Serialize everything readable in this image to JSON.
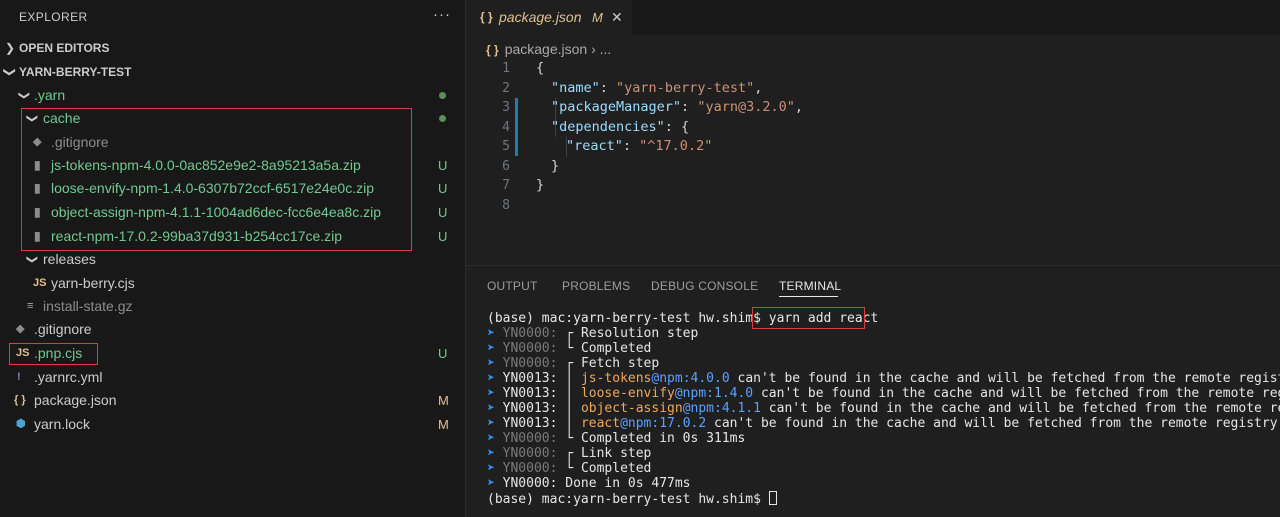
{
  "explorer": {
    "title": "EXPLORER",
    "more": "···",
    "open_editors": "OPEN EDITORS",
    "project": "YARN-BERRY-TEST",
    "tree": [
      {
        "name": ".yarn",
        "icon": "chevron-down",
        "status": "dot"
      },
      {
        "name": "cache",
        "icon": "chevron-down",
        "status": "dot"
      },
      {
        "name": ".gitignore",
        "icon": "gitignore-icon",
        "status": ""
      },
      {
        "name": "js-tokens-npm-4.0.0-0ac852e9e2-8a95213a5a.zip",
        "icon": "zip-icon",
        "status": "U"
      },
      {
        "name": "loose-envify-npm-1.4.0-6307b72ccf-6517e24e0c.zip",
        "icon": "zip-icon",
        "status": "U"
      },
      {
        "name": "object-assign-npm-4.1.1-1004ad6dec-fcc6e4ea8c.zip",
        "icon": "zip-icon",
        "status": "U"
      },
      {
        "name": "react-npm-17.0.2-99ba37d931-b254cc17ce.zip",
        "icon": "zip-icon",
        "status": "U"
      },
      {
        "name": "releases",
        "icon": "chevron-down",
        "status": ""
      },
      {
        "name": "yarn-berry.cjs",
        "icon": "js-icon",
        "status": ""
      },
      {
        "name": "install-state.gz",
        "icon": "lines-icon",
        "status": ""
      },
      {
        "name": ".gitignore",
        "icon": "gitignore-icon",
        "status": ""
      },
      {
        "name": ".pnp.cjs",
        "icon": "js-icon",
        "status": "U"
      },
      {
        "name": ".yarnrc.yml",
        "icon": "exclamation-icon",
        "status": ""
      },
      {
        "name": "package.json",
        "icon": "braces-icon",
        "status": "M"
      },
      {
        "name": "yarn.lock",
        "icon": "yarn-icon",
        "status": "M"
      }
    ]
  },
  "editor": {
    "tab_icon": "{ }",
    "tab_name": "package.json",
    "tab_status": "M",
    "tab_close": "✕",
    "breadcrumb_file": "package.json",
    "breadcrumb_rest": "› ...",
    "lines": [
      {
        "n": "1",
        "parts": [
          [
            "p",
            "{"
          ]
        ]
      },
      {
        "n": "2",
        "parts": [
          [
            "k",
            "\"name\""
          ],
          [
            "p",
            ": "
          ],
          [
            "s",
            "\"yarn-berry-test\""
          ],
          [
            "p",
            ","
          ]
        ]
      },
      {
        "n": "3",
        "parts": [
          [
            "k",
            "\"packageManager\""
          ],
          [
            "p",
            ": "
          ],
          [
            "s",
            "\"yarn@3.2.0\""
          ],
          [
            "p",
            ","
          ]
        ]
      },
      {
        "n": "4",
        "parts": [
          [
            "k",
            "\"dependencies\""
          ],
          [
            "p",
            ": {"
          ]
        ]
      },
      {
        "n": "5",
        "parts": [
          [
            "k",
            "\"react\""
          ],
          [
            "p",
            ": "
          ],
          [
            "s",
            "\"^17.0.2\""
          ]
        ]
      },
      {
        "n": "6",
        "parts": [
          [
            "p",
            "}"
          ]
        ]
      },
      {
        "n": "7",
        "parts": [
          [
            "p",
            "}"
          ]
        ]
      },
      {
        "n": "8",
        "parts": []
      }
    ]
  },
  "panel": {
    "tabs": [
      "OUTPUT",
      "PROBLEMS",
      "DEBUG CONSOLE",
      "TERMINAL"
    ],
    "active_tab": "TERMINAL",
    "prompt": "(base) mac:yarn-berry-test hw.shim$ ",
    "command": "yarn add react",
    "lines": [
      {
        "code": "YN0000:",
        "sym": "┌",
        "text": "Resolution step",
        "dim": true
      },
      {
        "code": "YN0000:",
        "sym": "└",
        "text": "Completed",
        "dim": true
      },
      {
        "code": "YN0000:",
        "sym": "┌",
        "text": "Fetch step",
        "dim": true
      },
      {
        "code": "YN0013:",
        "sym": "│",
        "pkg": "js-tokens",
        "ver": "@npm:4.0.0",
        "text": " can't be found in the cache and will be fetched from the remote registry",
        "dim": false
      },
      {
        "code": "YN0013:",
        "sym": "│",
        "pkg": "loose-envify",
        "ver": "@npm:1.4.0",
        "text": " can't be found in the cache and will be fetched from the remote regis",
        "dim": false
      },
      {
        "code": "YN0013:",
        "sym": "│",
        "pkg": "object-assign",
        "ver": "@npm:4.1.1",
        "text": " can't be found in the cache and will be fetched from the remote regi",
        "dim": false
      },
      {
        "code": "YN0013:",
        "sym": "│",
        "pkg": "react",
        "ver": "@npm:17.0.2",
        "text": " can't be found in the cache and will be fetched from the remote registry",
        "dim": false
      },
      {
        "code": "YN0000:",
        "sym": "└",
        "text": "Completed in 0s 311ms",
        "dim": true
      },
      {
        "code": "YN0000:",
        "sym": "┌",
        "text": "Link step",
        "dim": true
      },
      {
        "code": "YN0000:",
        "sym": "└",
        "text": "Completed",
        "dim": true
      },
      {
        "code": "YN0000:",
        "sym": "",
        "text": "Done in 0s 477ms",
        "dim": false
      }
    ],
    "final_prompt": "(base) mac:yarn-berry-test hw.shim$ "
  }
}
